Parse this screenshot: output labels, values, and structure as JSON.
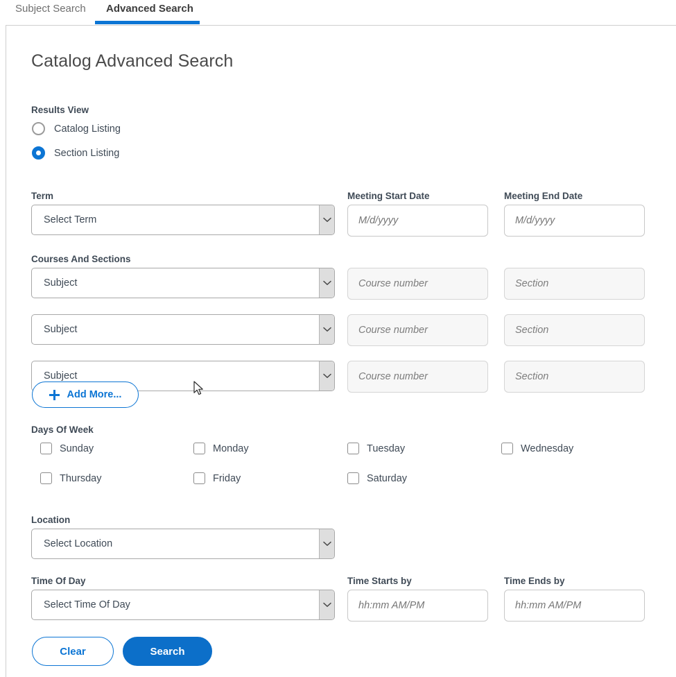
{
  "tabs": [
    {
      "label": "Subject Search",
      "active": false
    },
    {
      "label": "Advanced Search",
      "active": true
    }
  ],
  "page": {
    "title": "Catalog Advanced Search",
    "accent_color": "#0c75d4"
  },
  "results_view": {
    "label": "Results View",
    "options": [
      {
        "label": "Catalog Listing",
        "selected": false
      },
      {
        "label": "Section Listing",
        "selected": true
      }
    ]
  },
  "term": {
    "label": "Term",
    "select_value": "Select Term"
  },
  "meeting_start_date": {
    "label": "Meeting Start Date",
    "value": "",
    "placeholder": "M/d/yyyy"
  },
  "meeting_end_date": {
    "label": "Meeting End Date",
    "value": "",
    "placeholder": "M/d/yyyy"
  },
  "courses_and_sections": {
    "label": "Courses And Sections",
    "rows": [
      {
        "subject": "Subject",
        "course_number_placeholder": "Course number",
        "section_placeholder": "Section"
      },
      {
        "subject": "Subject",
        "course_number_placeholder": "Course number",
        "section_placeholder": "Section"
      },
      {
        "subject": "Subject",
        "course_number_placeholder": "Course number",
        "section_placeholder": "Section"
      }
    ],
    "add_more_label": "Add More..."
  },
  "days_of_week": {
    "label": "Days Of Week",
    "days": [
      {
        "label": "Sunday",
        "checked": false
      },
      {
        "label": "Monday",
        "checked": false
      },
      {
        "label": "Tuesday",
        "checked": false
      },
      {
        "label": "Wednesday",
        "checked": false
      },
      {
        "label": "Thursday",
        "checked": false
      },
      {
        "label": "Friday",
        "checked": false
      },
      {
        "label": "Saturday",
        "checked": false
      }
    ]
  },
  "location": {
    "label": "Location",
    "select_value": "Select Location"
  },
  "time_of_day": {
    "label": "Time Of Day",
    "select_value": "Select Time Of Day"
  },
  "time_starts_by": {
    "label": "Time Starts by",
    "value": "",
    "placeholder": "hh:mm AM/PM"
  },
  "time_ends_by": {
    "label": "Time Ends by",
    "value": "",
    "placeholder": "hh:mm AM/PM"
  },
  "actions": {
    "clear_label": "Clear",
    "search_label": "Search"
  },
  "icons": {
    "chevron_down": "chevron-down-icon",
    "plus": "plus-icon",
    "cursor": "mouse-cursor"
  }
}
